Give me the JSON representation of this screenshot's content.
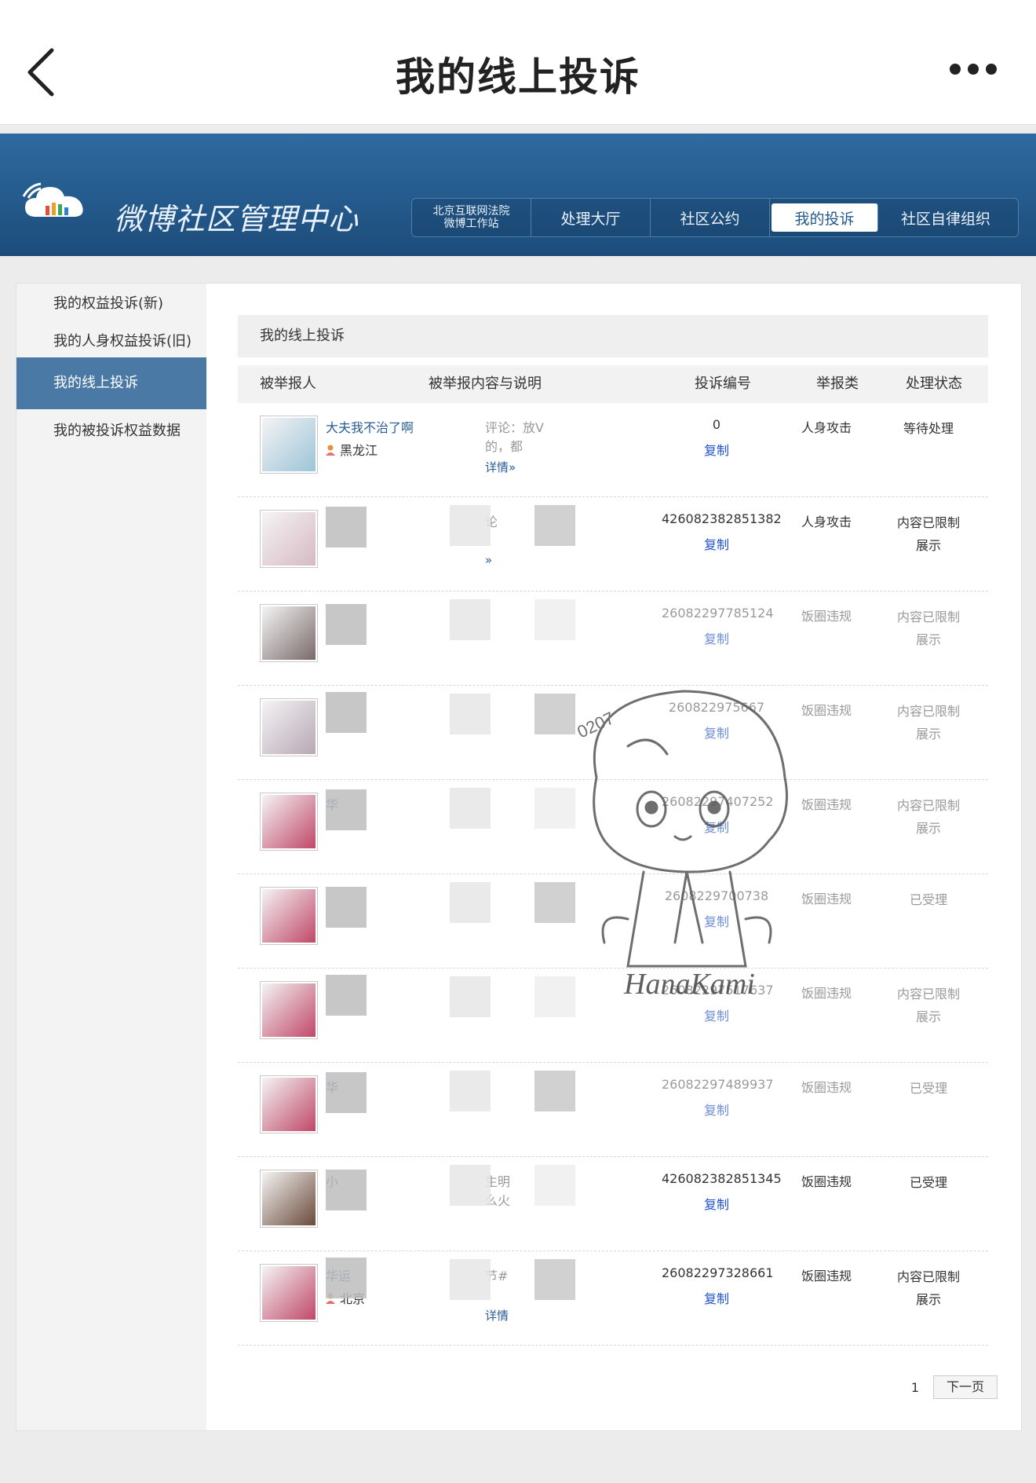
{
  "topbar": {
    "title": "我的线上投诉"
  },
  "banner": {
    "title": "微博社区管理中心",
    "nav": [
      {
        "line1": "北京互联网法院",
        "line2": "微博工作站"
      },
      {
        "label": "处理大厅"
      },
      {
        "label": "社区公约"
      },
      {
        "label": "我的投诉"
      },
      {
        "label": "社区自律组织"
      }
    ]
  },
  "sidebar": {
    "items": [
      {
        "label": "我的权益投诉(新)"
      },
      {
        "label": "我的人身权益投诉(旧)"
      },
      {
        "label": "我的线上投诉",
        "active": true
      },
      {
        "label": "我的被投诉权益数据"
      }
    ]
  },
  "content": {
    "header": "我的线上投诉",
    "columns": {
      "reporter": "被举报人",
      "detail": "被举报内容与说明",
      "id": "投诉编号",
      "type": "举报类",
      "status": "处理状态"
    },
    "rows": [
      {
        "reporter": "大夫我不治了啊",
        "location": "黑龙江",
        "detail": "评论：放V",
        "detail2": "的，都",
        "detail_link": "详情»",
        "id": "0",
        "copy": "复制",
        "type": "人身攻击",
        "status": "等待处理",
        "status2": "",
        "avatar_color": "#9cc4d8"
      },
      {
        "reporter": "",
        "location": "",
        "detail": "论",
        "detail2": "",
        "detail_link": "»",
        "id": "426082382851382",
        "copy": "复制",
        "type": "人身攻击",
        "status": "内容已限制",
        "status2": "展示",
        "avatar_color": "#d7b9c3"
      },
      {
        "reporter": "",
        "location": "",
        "detail": "",
        "detail2": "",
        "detail_link": "",
        "id": "26082297785124",
        "copy": "复制",
        "type": "饭圈违规",
        "status": "内容已限制",
        "status2": "展示",
        "avatar_color": "#7a6a6a"
      },
      {
        "reporter": "",
        "location": "",
        "detail": "",
        "detail2": "",
        "detail_link": "",
        "id": "260822975667",
        "copy": "复制",
        "type": "饭圈违规",
        "status": "内容已限制",
        "status2": "展示",
        "avatar_color": "#b7a8b5"
      },
      {
        "reporter": "华",
        "location": "",
        "detail": "",
        "detail2": "",
        "detail_link": "",
        "id": "26082297407252",
        "copy": "复制",
        "type": "饭圈违规",
        "status": "内容已限制",
        "status2": "展示",
        "avatar_color": "#c04868"
      },
      {
        "reporter": "",
        "location": "",
        "detail": "",
        "detail2": "",
        "detail_link": "",
        "id": "2608229700738",
        "copy": "复制",
        "type": "饭圈违规",
        "status": "已受理",
        "status2": "",
        "avatar_color": "#c04868"
      },
      {
        "reporter": "",
        "location": "",
        "detail": "",
        "detail2": "",
        "detail_link": "",
        "id": "26082297517637",
        "copy": "复制",
        "type": "饭圈违规",
        "status": "内容已限制",
        "status2": "展示",
        "avatar_color": "#c04868"
      },
      {
        "reporter": "华",
        "location": "",
        "detail": "",
        "detail2": "",
        "detail_link": "",
        "id": "26082297489937",
        "copy": "复制",
        "type": "饭圈违规",
        "status": "已受理",
        "status2": "",
        "avatar_color": "#c04868"
      },
      {
        "reporter": "小",
        "location": "",
        "detail": "生明",
        "detail2": "么火",
        "detail_link": "",
        "id": "426082382851345",
        "copy": "复制",
        "type": "饭圈违规",
        "status": "已受理",
        "status2": "",
        "avatar_color": "#6b4a3a"
      },
      {
        "reporter": "华运",
        "location": "北京",
        "detail": "节#",
        "detail2": "",
        "detail_link": "详情",
        "id": "26082297328661",
        "copy": "复制",
        "type": "饭圈违规",
        "status": "内容已限制",
        "status2": "展示",
        "avatar_color": "#c04868"
      }
    ],
    "pager": {
      "page": "1",
      "next": "下一页"
    }
  },
  "watermark": {
    "text": "HanaKami",
    "code": "0207"
  },
  "colors": {
    "banner": "#245a8c",
    "sidebar_active": "#4a79a6",
    "link": "#2a5b93",
    "copy": "#1f53c8"
  }
}
